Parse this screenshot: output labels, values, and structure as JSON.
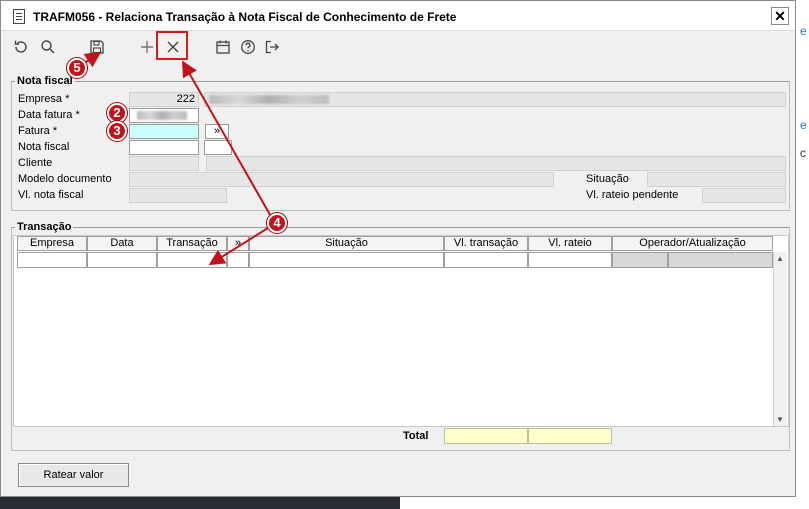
{
  "window": {
    "title": "TRAFM056 - Relaciona Transação à Nota Fiscal de Conhecimento de Frete",
    "close_glyph": "✕"
  },
  "toolbar": {
    "icons": [
      "refresh-icon",
      "search-icon",
      "save-icon",
      "add-icon",
      "cancel-icon",
      "calendar-icon",
      "help-icon",
      "exit-icon"
    ]
  },
  "nota_fiscal": {
    "group_title": "Nota fiscal",
    "empresa_label": "Empresa *",
    "empresa_value": "222",
    "data_fatura_label": "Data fatura *",
    "fatura_label": "Fatura *",
    "fatura_lookup": "»",
    "nota_fiscal_label": "Nota fiscal",
    "cliente_label": "Cliente",
    "modelo_label": "Modelo documento",
    "situacao_label": "Situação",
    "vl_nota_label": "Vl. nota fiscal",
    "vl_rateio_pendente_label": "Vl. rateio pendente"
  },
  "transacao": {
    "group_title": "Transação",
    "columns": [
      "Empresa",
      "Data",
      "Transação",
      "»",
      "Situação",
      "Vl. transação",
      "Vl. rateio",
      "Operador/Atualização"
    ],
    "total_label": "Total"
  },
  "buttons": {
    "ratear_label": "Ratear valor"
  },
  "callouts": [
    "2",
    "3",
    "4",
    "5"
  ],
  "background": {
    "right_chars": [
      "e",
      "e",
      "c"
    ]
  },
  "colors": {
    "callout_red": "#c0141a",
    "highlight_red": "#d01d1d",
    "required_field_cyan": "#ccfdfd",
    "total_field_yellow": "#ffffcc"
  }
}
